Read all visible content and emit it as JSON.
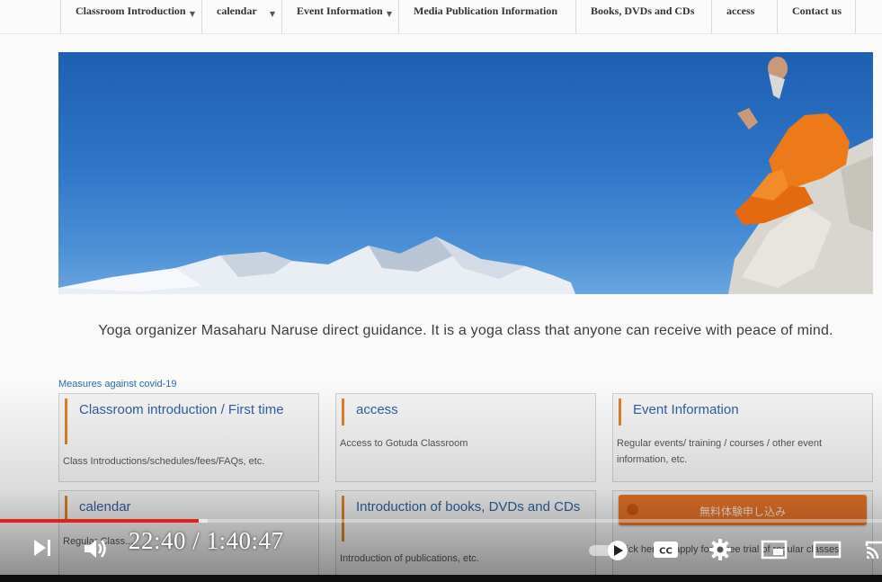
{
  "nav": {
    "items": [
      {
        "label": "Classroom Introduction",
        "dropdown": true
      },
      {
        "label": "calendar",
        "dropdown": true
      },
      {
        "label": "Event Information",
        "dropdown": true
      },
      {
        "label": "Media Publication Information",
        "dropdown": false
      },
      {
        "label": "Books, DVDs and CDs",
        "dropdown": false
      },
      {
        "label": "access",
        "dropdown": false
      },
      {
        "label": "Contact us",
        "dropdown": false
      }
    ]
  },
  "tagline": "Yoga organizer Masaharu Naruse direct guidance. It is a yoga class that anyone can receive with peace of mind.",
  "covid_link": "Measures against covid-19",
  "cards": [
    {
      "title": "Classroom introduction / First time",
      "desc": "Class Introductions/schedules/fees/FAQs, etc."
    },
    {
      "title": "access",
      "desc": "Access to Gotuda Classroom"
    },
    {
      "title": "Event Information",
      "desc": "Regular events/ training / courses / other event information, etc."
    },
    {
      "title": "calendar",
      "desc": "Regular Class..."
    },
    {
      "title": "Introduction of books, DVDs and CDs",
      "desc": "Introduction of publications, etc."
    }
  ],
  "trial_button": {
    "label": "無料体験申し込み",
    "icon": "circle-icon"
  },
  "trial_note": "Click here to apply for a free trial of regular classes",
  "video": {
    "current_time": "22:40",
    "separator": " / ",
    "duration": "1:40:47",
    "played_fraction": 0.2249,
    "buffered_fraction": 0.235,
    "autoplay": true,
    "controls": {
      "next": "next-icon",
      "volume": "volume-icon",
      "captions": "CC",
      "settings": "gear-icon",
      "miniplayer": "miniplayer-icon",
      "theater": "theater-icon",
      "cast": "cast-icon"
    },
    "accent": "#e62117"
  }
}
